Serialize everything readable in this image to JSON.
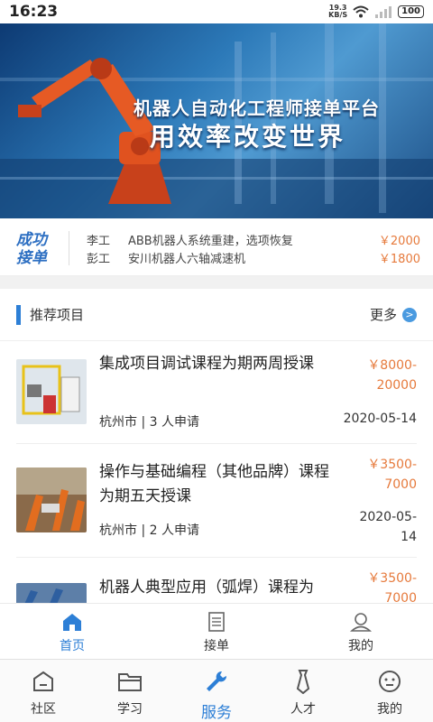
{
  "status_bar": {
    "time": "16:23",
    "net_speed": "19.3",
    "net_unit": "KB/S",
    "battery": "100"
  },
  "banner": {
    "line1": "机器人自动化工程师接单平台",
    "line2": "用效率改变世界"
  },
  "success_orders": {
    "badge": "成功接单",
    "rows": [
      {
        "who": "李工",
        "what": "ABB机器人系统重建，选项恢复",
        "amount": "￥2000"
      },
      {
        "who": "彭工",
        "what": "安川机器人六轴减速机",
        "amount": "￥1800"
      }
    ]
  },
  "recommend": {
    "title": "推荐项目",
    "more": "更多",
    "items": [
      {
        "name": "集成项目调试课程为期两周授课",
        "price_line1": "￥8000-",
        "price_line2": "20000",
        "meta": "杭州市 | 3 人申请",
        "date_line1": "2020-05-14",
        "date_line2": ""
      },
      {
        "name": "操作与基础编程（其他品牌）课程为期五天授课",
        "price_line1": "￥3500-",
        "price_line2": "7000",
        "meta": "杭州市 | 2 人申请",
        "date_line1": "2020-05-",
        "date_line2": "14"
      },
      {
        "name": "机器人典型应用（弧焊）课程为",
        "price_line1": "￥3500-",
        "price_line2": "7000",
        "meta": "",
        "date_line1": "",
        "date_line2": ""
      }
    ]
  },
  "sub_nav": [
    {
      "label": "首页",
      "icon": "home-icon",
      "active": true
    },
    {
      "label": "接单",
      "icon": "document-icon",
      "active": false
    },
    {
      "label": "我的",
      "icon": "user-icon",
      "active": false
    }
  ],
  "tab_bar": [
    {
      "label": "社区",
      "icon": "community-icon",
      "active": false
    },
    {
      "label": "学习",
      "icon": "folder-icon",
      "active": false
    },
    {
      "label": "服务",
      "icon": "wrench-icon",
      "active": true
    },
    {
      "label": "人才",
      "icon": "tie-icon",
      "active": false
    },
    {
      "label": "我的",
      "icon": "face-icon",
      "active": false
    }
  ],
  "colors": {
    "accent": "#2d7fd6",
    "price": "#e67a3c"
  }
}
